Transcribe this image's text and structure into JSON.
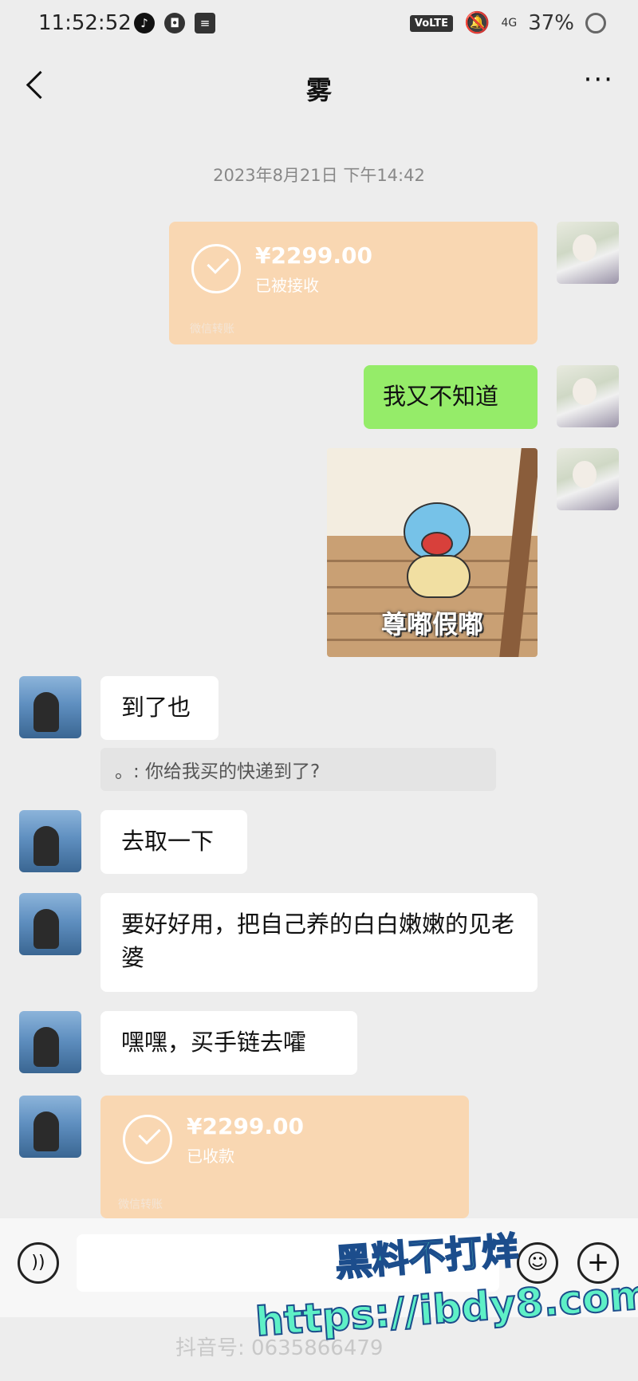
{
  "status_bar": {
    "time": "11:52:52",
    "network": "VoLTE",
    "signal": "4G",
    "battery": "37%"
  },
  "header": {
    "title": "雾"
  },
  "timestamp": "2023年8月21日 下午14:42",
  "messages": {
    "transfer_1": {
      "amount": "¥2299.00",
      "status": "已被接收",
      "footer": "微信转账"
    },
    "me_text": "我又不知道",
    "sticker_caption": "尊嘟假嘟",
    "them_1": "到了也",
    "quote_1": "。: 你给我买的快递到了?",
    "them_2": "去取一下",
    "them_3": "要好好用，把自己养的白白嫩嫩的见老婆",
    "them_4": "嘿嘿，买手链去嚯",
    "transfer_2": {
      "amount": "¥2299.00",
      "status": "已收款",
      "footer": "微信转账"
    }
  },
  "input": {
    "placeholder": ""
  },
  "watermarks": {
    "douyin": "抖音号: 0635866479",
    "promo_line1": "黑料不打烊",
    "promo_line2": "https://ibdy8.com"
  },
  "colors": {
    "background": "#ededed",
    "green_bubble": "#95ec69",
    "transfer_orange": "#f9d7b2"
  }
}
